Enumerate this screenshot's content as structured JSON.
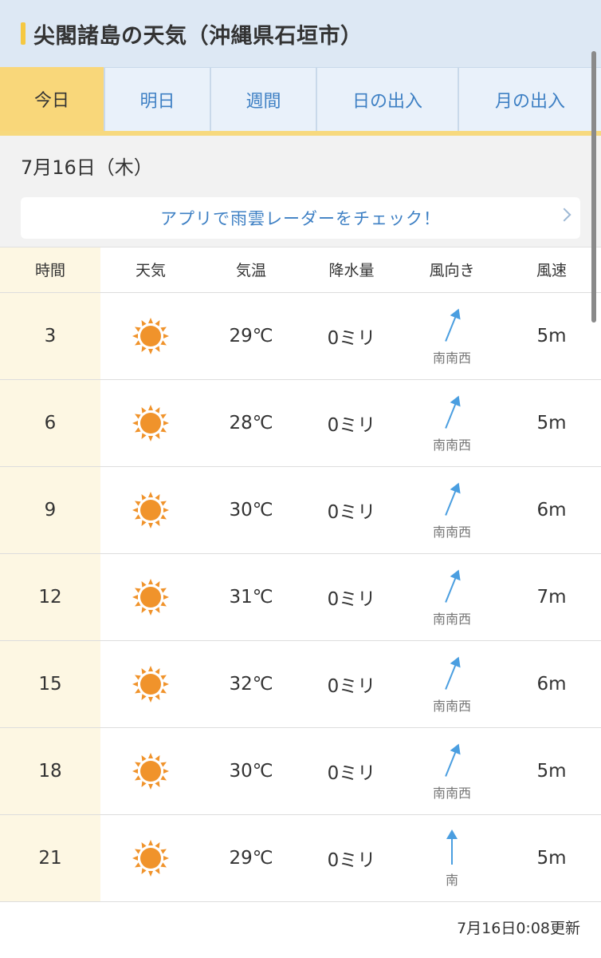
{
  "header": {
    "title": "尖閣諸島の天気（沖縄県石垣市）"
  },
  "tabs": [
    {
      "label": "今日"
    },
    {
      "label": "明日"
    },
    {
      "label": "週間"
    },
    {
      "label": "日の出入"
    },
    {
      "label": "月の出入"
    }
  ],
  "date_label": "7月16日（木）",
  "app_banner": {
    "label": "アプリで雨雲レーダーをチェック！"
  },
  "table": {
    "headers": [
      "時間",
      "天気",
      "気温",
      "降水量",
      "風向き",
      "風速"
    ],
    "rows": [
      {
        "time": "3",
        "weather_icon": "sun-icon",
        "temp": "29℃",
        "precip": "0ミリ",
        "wind_dir": "南南西",
        "wind_speed": "5m"
      },
      {
        "time": "6",
        "weather_icon": "sun-icon",
        "temp": "28℃",
        "precip": "0ミリ",
        "wind_dir": "南南西",
        "wind_speed": "5m"
      },
      {
        "time": "9",
        "weather_icon": "sun-icon",
        "temp": "30℃",
        "precip": "0ミリ",
        "wind_dir": "南南西",
        "wind_speed": "6m"
      },
      {
        "time": "12",
        "weather_icon": "sun-icon",
        "temp": "31℃",
        "precip": "0ミリ",
        "wind_dir": "南南西",
        "wind_speed": "7m"
      },
      {
        "time": "15",
        "weather_icon": "sun-icon",
        "temp": "32℃",
        "precip": "0ミリ",
        "wind_dir": "南南西",
        "wind_speed": "6m"
      },
      {
        "time": "18",
        "weather_icon": "sun-icon",
        "temp": "30℃",
        "precip": "0ミリ",
        "wind_dir": "南南西",
        "wind_speed": "5m"
      },
      {
        "time": "21",
        "weather_icon": "sun-icon",
        "temp": "29℃",
        "precip": "0ミリ",
        "wind_dir": "南",
        "wind_speed": "5m"
      }
    ]
  },
  "footer": {
    "updated": "7月16日0:08更新"
  },
  "colors": {
    "accent_blue": "#3e80c4",
    "tab_active": "#f9d77a",
    "sun": "#f0932b",
    "arrow": "#4a9ee0"
  }
}
